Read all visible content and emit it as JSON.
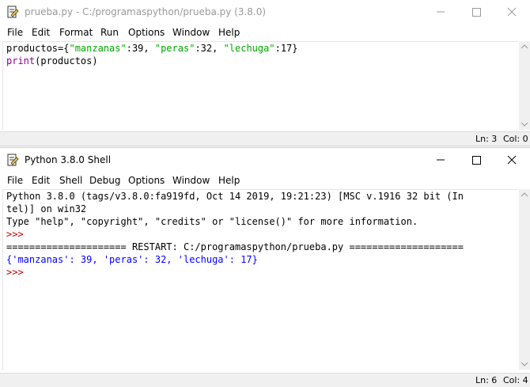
{
  "editor": {
    "title": "prueba.py - C:/programaspython/prueba.py (3.8.0)",
    "menu": [
      "File",
      "Edit",
      "Format",
      "Run",
      "Options",
      "Window",
      "Help"
    ],
    "code_lines": [
      [
        {
          "text": "productos={",
          "color": "#000000"
        },
        {
          "text": "\"manzanas\"",
          "color": "#00aa00"
        },
        {
          "text": ":39, ",
          "color": "#000000"
        },
        {
          "text": "\"peras\"",
          "color": "#00aa00"
        },
        {
          "text": ":32, ",
          "color": "#000000"
        },
        {
          "text": "\"lechuga\"",
          "color": "#00aa00"
        },
        {
          "text": ":17}",
          "color": "#000000"
        }
      ],
      [
        {
          "text": "print",
          "color": "#900090"
        },
        {
          "text": "(productos)",
          "color": "#000000"
        }
      ]
    ],
    "status": {
      "line": "Ln: 3",
      "col": "Col: 0"
    }
  },
  "shell": {
    "title": "Python 3.8.0 Shell",
    "menu": [
      "File",
      "Edit",
      "Shell",
      "Debug",
      "Options",
      "Window",
      "Help"
    ],
    "code_lines": [
      [
        {
          "text": "Python 3.8.0 (tags/v3.8.0:fa919fd, Oct 14 2019, 19:21:23) [MSC v.1916 32 bit (In",
          "color": "#000000"
        }
      ],
      [
        {
          "text": "tel)] on win32",
          "color": "#000000"
        }
      ],
      [
        {
          "text": "Type \"help\", \"copyright\", \"credits\" or \"license()\" for more information.",
          "color": "#000000"
        }
      ],
      [
        {
          "text": ">>> ",
          "color": "#c00000"
        }
      ],
      [
        {
          "text": "===================== RESTART: C:/programaspython/prueba.py ====================",
          "color": "#000000"
        }
      ],
      [
        {
          "text": "{'manzanas': 39, 'peras': 32, 'lechuga': 17}",
          "color": "#0000ff"
        }
      ],
      [
        {
          "text": ">>> ",
          "color": "#c00000"
        }
      ]
    ],
    "status": {
      "line": "Ln: 6",
      "col": "Col: 4"
    }
  }
}
